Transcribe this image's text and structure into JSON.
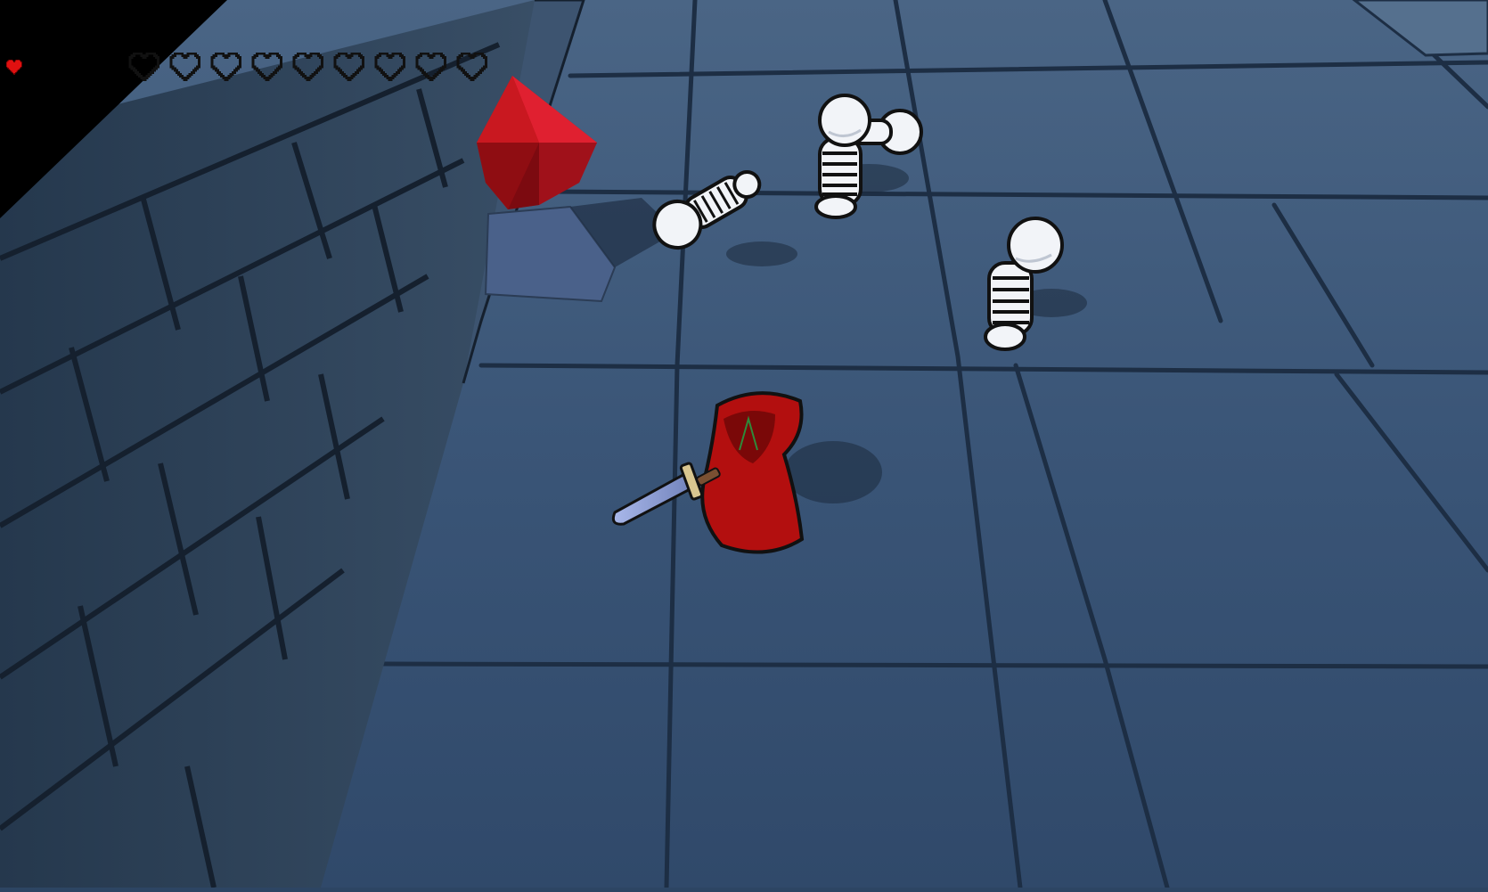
{
  "game": {
    "scene": "dungeon-corridor",
    "player": {
      "type": "hooded-swordsman",
      "cloak_color": "#b30f0f",
      "weapon": "sword"
    },
    "pickup": {
      "type": "red-crystal",
      "color": "#c1141a"
    },
    "enemies": [
      {
        "type": "skeleton",
        "state": "standing"
      },
      {
        "type": "skeleton",
        "state": "walking"
      },
      {
        "type": "skeleton",
        "state": "fallen"
      }
    ]
  },
  "hud": {
    "health": {
      "filled": 1,
      "max": 10,
      "full_icon": "heart-full-icon",
      "empty_icon": "heart-empty-icon",
      "color_full": "#e01010",
      "color_empty": "#111111"
    }
  },
  "colors": {
    "floor": "#3a5577",
    "floor_grout": "#1d2e44",
    "wall_top": "#2a3a4c",
    "wall_face": "#33475e",
    "bone": "#f2f4f8",
    "outline": "#111111"
  }
}
